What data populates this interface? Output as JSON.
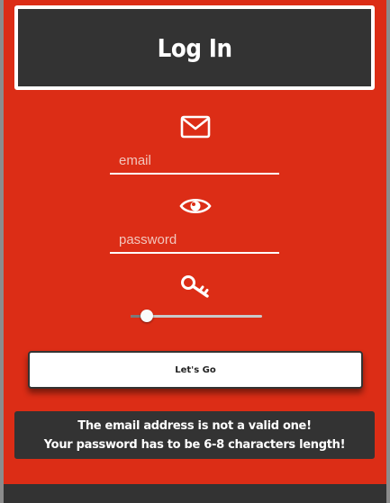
{
  "header": {
    "title": "Log In"
  },
  "form": {
    "email": {
      "placeholder": "email",
      "value": "",
      "icon": "envelope-icon"
    },
    "password": {
      "placeholder": "password",
      "value": "",
      "icon": "eye-icon"
    },
    "strength": {
      "icon": "key-icon",
      "value": 0.12
    },
    "submit_label": "Let's Go"
  },
  "errors": {
    "lines": [
      "The email address is not a valid one!",
      "Your password has to be 6-8 characters length!"
    ]
  },
  "colors": {
    "background": "#dc2d16",
    "panel": "#333333",
    "text": "#ffffff"
  }
}
